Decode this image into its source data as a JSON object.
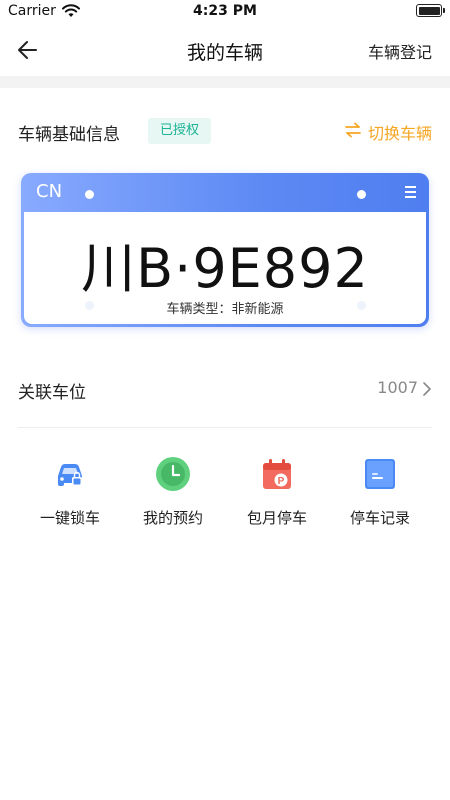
{
  "status_bar": {
    "carrier": "Carrier",
    "time": "4:23 PM"
  },
  "nav": {
    "title": "我的车辆",
    "right_action": "车辆登记"
  },
  "vehicle_info": {
    "label": "车辆基础信息",
    "badge": "已授权",
    "switch_label": "切换车辆"
  },
  "plate": {
    "country": "CN",
    "number": "川B·9E892",
    "type_text": "车辆类型：非新能源"
  },
  "parking": {
    "label": "关联车位",
    "value": "1007"
  },
  "actions": [
    {
      "label": "一键锁车",
      "icon": "car-lock-icon"
    },
    {
      "label": "我的预约",
      "icon": "clock-icon"
    },
    {
      "label": "包月停车",
      "icon": "calendar-parking-icon"
    },
    {
      "label": "停车记录",
      "icon": "record-icon"
    }
  ],
  "colors": {
    "accent_orange": "#f5a623",
    "badge_green": "#1ab394",
    "badge_bg": "#e7f7f3",
    "plate_blue": "#5c89f3"
  }
}
